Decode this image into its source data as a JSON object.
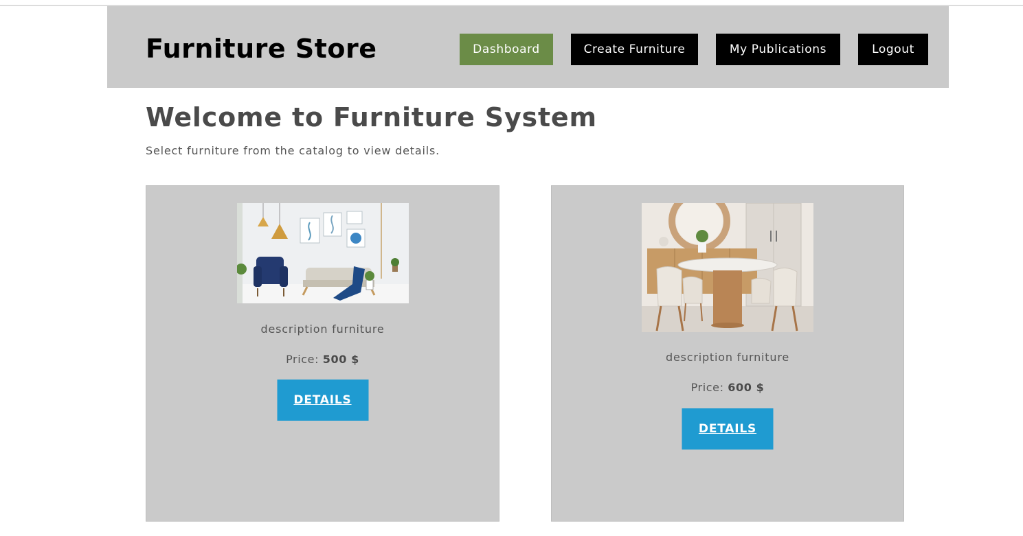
{
  "header": {
    "brand": "Furniture Store",
    "nav": [
      {
        "label": "Dashboard",
        "active": true
      },
      {
        "label": "Create Furniture"
      },
      {
        "label": "My Publications"
      },
      {
        "label": "Logout"
      }
    ]
  },
  "main": {
    "title": "Welcome to Furniture System",
    "subtitle": "Select furniture from the catalog to view details."
  },
  "catalog": [
    {
      "image": "living-room-photo",
      "description": "description furniture",
      "price_label": "Price:",
      "price": "500 $",
      "details_label": "DETAILS"
    },
    {
      "image": "dining-table-photo",
      "description": "description furniture",
      "price_label": "Price:",
      "price": "600 $",
      "details_label": "DETAILS"
    }
  ],
  "colors": {
    "header_bg": "#cacaca",
    "active_nav": "#6b8c47",
    "nav": "#000000",
    "details_button": "#1f9bd1",
    "card_bg": "#cacaca"
  }
}
